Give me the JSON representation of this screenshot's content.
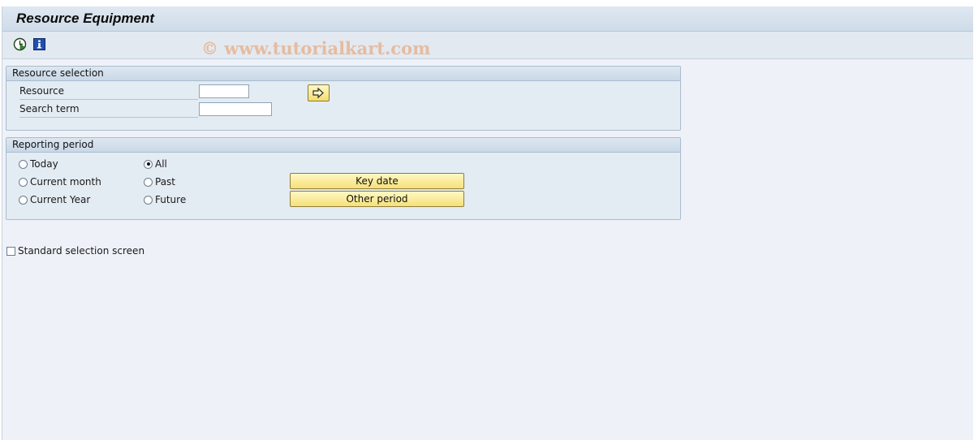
{
  "window": {
    "title": "Resource Equipment"
  },
  "toolbar": {
    "execute_icon": "execute-clock-icon",
    "info_icon": "info-icon"
  },
  "watermark": "© www.tutorialkart.com",
  "resource_selection": {
    "title": "Resource selection",
    "resource_label": "Resource",
    "resource_value": "",
    "search_term_label": "Search term",
    "search_term_value": "",
    "arrow_icon": "arrow-right-icon"
  },
  "reporting_period": {
    "title": "Reporting period",
    "options_left": [
      {
        "label": "Today",
        "checked": false
      },
      {
        "label": "Current month",
        "checked": false
      },
      {
        "label": "Current Year",
        "checked": false
      }
    ],
    "options_right": [
      {
        "label": "All",
        "checked": true
      },
      {
        "label": "Past",
        "checked": false
      },
      {
        "label": "Future",
        "checked": false
      }
    ],
    "key_date_label": "Key date",
    "other_period_label": "Other period"
  },
  "standard_selection": {
    "label": "Standard selection screen",
    "checked": false
  },
  "colors": {
    "background": "#eef2f8",
    "group_background": "#e4ecf3",
    "button_yellow": "#f6e07a",
    "watermark": "#eb965a"
  }
}
